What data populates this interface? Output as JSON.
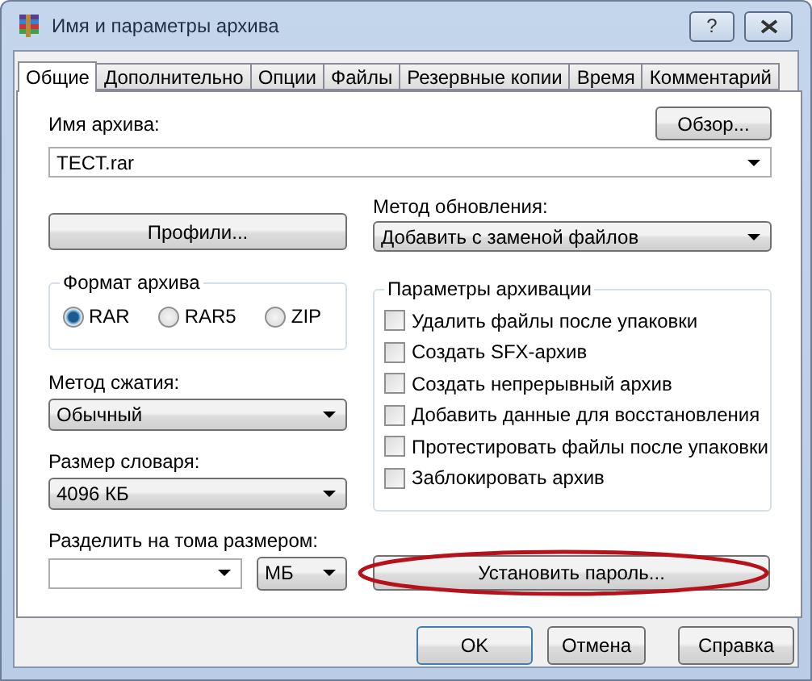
{
  "window": {
    "title": "Имя и параметры архива",
    "help_button": "?"
  },
  "tabs": [
    {
      "label": "Общие",
      "selected": true
    },
    {
      "label": "Дополнительно",
      "selected": false
    },
    {
      "label": "Опции",
      "selected": false
    },
    {
      "label": "Файлы",
      "selected": false
    },
    {
      "label": "Резервные копии",
      "selected": false
    },
    {
      "label": "Время",
      "selected": false
    },
    {
      "label": "Комментарий",
      "selected": false
    }
  ],
  "archive_name": {
    "label": "Имя архива:",
    "value": "TECT.rar",
    "browse_button": "Обзор..."
  },
  "profiles_button": "Профили...",
  "update_method": {
    "label": "Метод обновления:",
    "value": "Добавить с заменой файлов"
  },
  "archive_format": {
    "title": "Формат архива",
    "options": [
      {
        "label": "RAR",
        "selected": true
      },
      {
        "label": "RAR5",
        "selected": false
      },
      {
        "label": "ZIP",
        "selected": false
      }
    ]
  },
  "compression_method": {
    "label": "Метод сжатия:",
    "value": "Обычный"
  },
  "dictionary_size": {
    "label": "Размер словаря:",
    "value": "4096 КБ"
  },
  "archiving_options": {
    "title": "Параметры архивации",
    "items": [
      {
        "label": "Удалить файлы после упаковки",
        "checked": false
      },
      {
        "label": "Создать SFX-архив",
        "checked": false
      },
      {
        "label": "Создать непрерывный архив",
        "checked": false
      },
      {
        "label": "Добавить данные для восстановления",
        "checked": false
      },
      {
        "label": "Протестировать файлы после упаковки",
        "checked": false
      },
      {
        "label": "Заблокировать архив",
        "checked": false
      }
    ]
  },
  "split_volumes": {
    "label": "Разделить на тома размером:",
    "unit": "МБ"
  },
  "password_button": {
    "label": "Установить пароль...",
    "highlighted": true
  },
  "buttons": [
    "OK",
    "Отмена",
    "Справка"
  ]
}
